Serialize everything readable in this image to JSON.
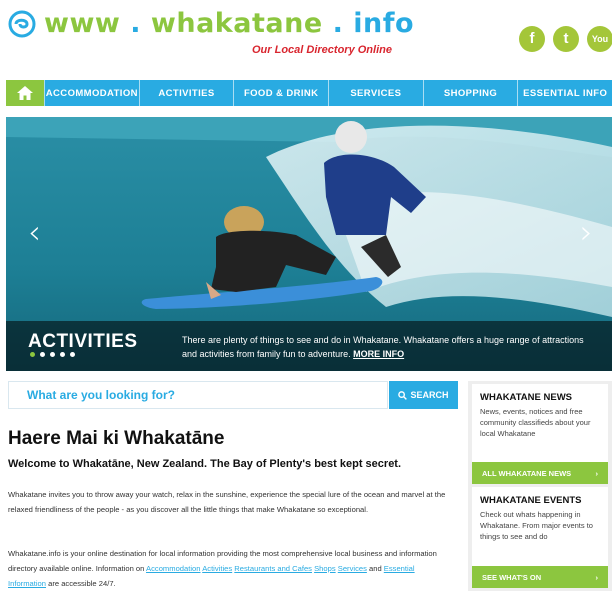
{
  "header": {
    "logo_www": "www",
    "logo_dot1": ".",
    "logo_name": "whakatane",
    "logo_dot2": ".",
    "logo_tld": "info",
    "tagline": "Our Local Directory Online",
    "social": [
      {
        "name": "facebook-icon",
        "glyph": "f"
      },
      {
        "name": "twitter-icon",
        "glyph": "t"
      },
      {
        "name": "youtube-icon",
        "glyph": "You"
      }
    ]
  },
  "nav": {
    "home_icon": "home-icon",
    "items": [
      "Accommodation",
      "Activities",
      "Food & Drink",
      "Services",
      "Shopping",
      "Essential Info"
    ]
  },
  "hero": {
    "title": "ACTIVITIES",
    "caption": "There are plenty of things to see and do in Whakatane. Whakatane offers a huge range of attractions and activities from family fun to adventure.",
    "more_label": "MORE INFO",
    "prev_arrow": "‹",
    "next_arrow": "›",
    "slide_count": 5,
    "active_slide": 1
  },
  "search": {
    "placeholder": "What are you looking for?",
    "button_label": "SEARCH"
  },
  "main": {
    "title": "Haere Mai ki Whakatāne",
    "welcome": "Welcome to Whakatāne, New Zealand. The Bay of Plenty's best kept secret.",
    "para1": "Whakatane invites you to throw away your watch, relax in the sunshine, experience the special lure of the ocean and marvel at the relaxed friendliness of the people - as you discover all the little things that make Whakatane so exceptional.",
    "para2_start": "Whakatane.info is your online destination for local information providing the most comprehensive local business and information directory available online. Information on ",
    "links": [
      "Accommodation",
      "Activities",
      "Restaurants and Cafes",
      "Shops",
      "Services",
      "Essential Information"
    ],
    "para2_and": " and ",
    "para2_end": " are accessible 24/7."
  },
  "sidebar": {
    "news_title": "WHAKATANE NEWS",
    "news_text": "News, events, notices and free community classifieds about your local Whakatane",
    "news_cta": "ALL WHAKATANE NEWS",
    "events_title": "WHAKATANE EVENTS",
    "events_text": "Check out whats happening in Whakatane. From major events to things to see and do",
    "events_cta": "SEE WHAT'S ON",
    "cta_arrow": "›"
  },
  "colors": {
    "brand_green": "#8cc63f",
    "brand_blue": "#29abe2",
    "tagline_red": "#d9262f"
  }
}
